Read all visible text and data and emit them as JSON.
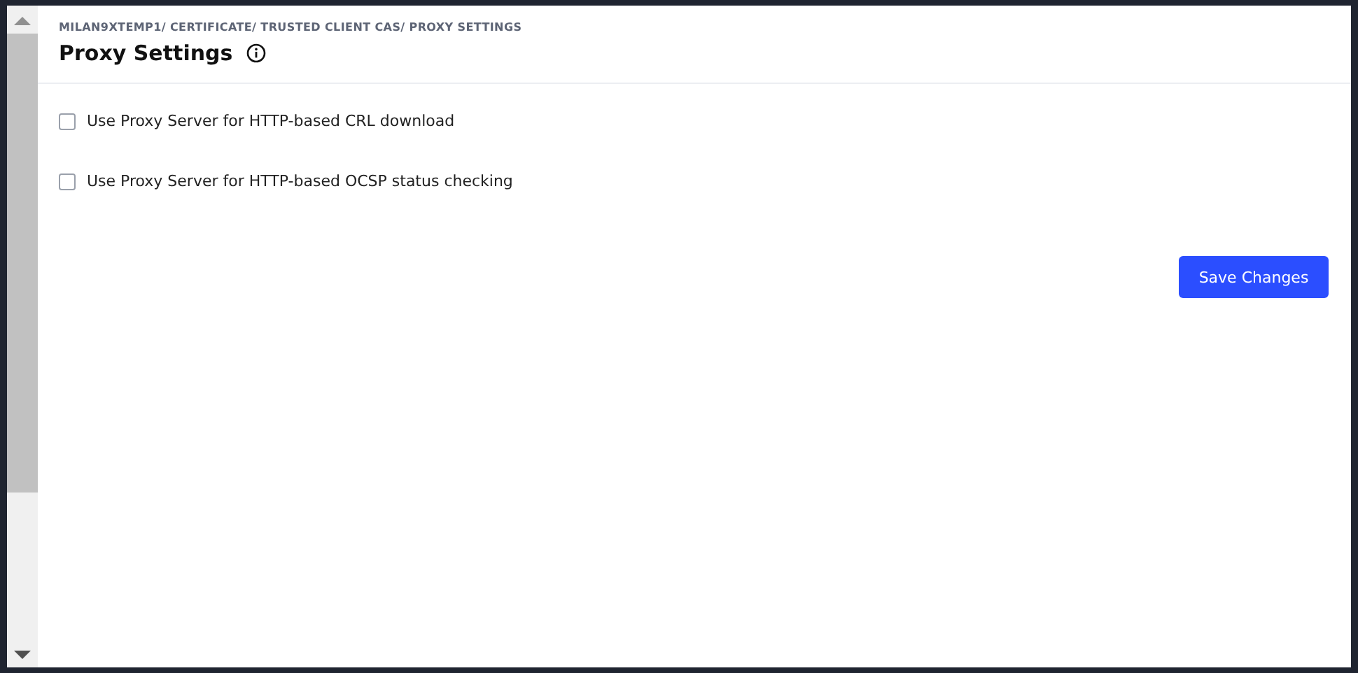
{
  "breadcrumb": "MILAN9XTEMP1/ CERTIFICATE/ TRUSTED CLIENT CAS/ PROXY SETTINGS",
  "title": "Proxy Settings",
  "options": [
    {
      "label": "Use Proxy Server for HTTP-based CRL download",
      "checked": false
    },
    {
      "label": "Use Proxy Server for HTTP-based OCSP status checking",
      "checked": false
    }
  ],
  "save_button": "Save Changes"
}
